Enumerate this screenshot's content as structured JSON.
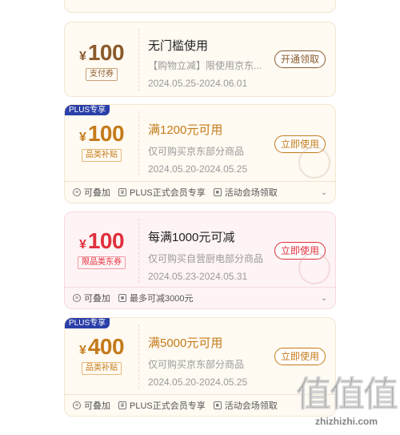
{
  "coupons": [
    {
      "amount": "100",
      "currency": "¥",
      "tag": "支付券",
      "plus_badge": "",
      "title": "无门槛使用",
      "desc": "【购物立减】限使用京东...",
      "date": "2024.05.25-2024.06.01",
      "button": "开通领取",
      "footer": []
    },
    {
      "amount": "100",
      "currency": "¥",
      "tag": "品类补贴",
      "plus_badge": "PLUS专享",
      "title": "满1200元可用",
      "desc": "仅可购买京东部分商品",
      "date": "2024.05.20-2024.05.25",
      "button": "立即使用",
      "footer": [
        "可叠加",
        "PLUS正式会员专享",
        "活动会场领取"
      ]
    },
    {
      "amount": "100",
      "currency": "¥",
      "tag": "限品类东券",
      "plus_badge": "",
      "title": "每满1000元可减",
      "desc": "仅可购买自营厨电部分商品",
      "date": "2024.05.23-2024.05.31",
      "button": "立即使用",
      "footer": [
        "可叠加",
        "最多可减3000元"
      ]
    },
    {
      "amount": "400",
      "currency": "¥",
      "tag": "品类补贴",
      "plus_badge": "PLUS专享",
      "title": "满5000元可用",
      "desc": "仅可购买京东部分商品",
      "date": "2024.05.20-2024.05.25",
      "button": "立即使用",
      "footer": [
        "可叠加",
        "PLUS正式会员专享",
        "活动会场领取"
      ]
    }
  ],
  "watermark": {
    "logo": "值值值",
    "url": "zhizhizhi.com"
  },
  "colors": {
    "brown": "#8b5a2b",
    "gold": "#c47b1a",
    "red": "#e0303c",
    "plus_blue": "#2a3fa8"
  },
  "icons": {
    "stack": "stack-icon",
    "crown": "crown-icon",
    "square": "square-dot-icon",
    "chevron": "chevron-down-icon"
  }
}
